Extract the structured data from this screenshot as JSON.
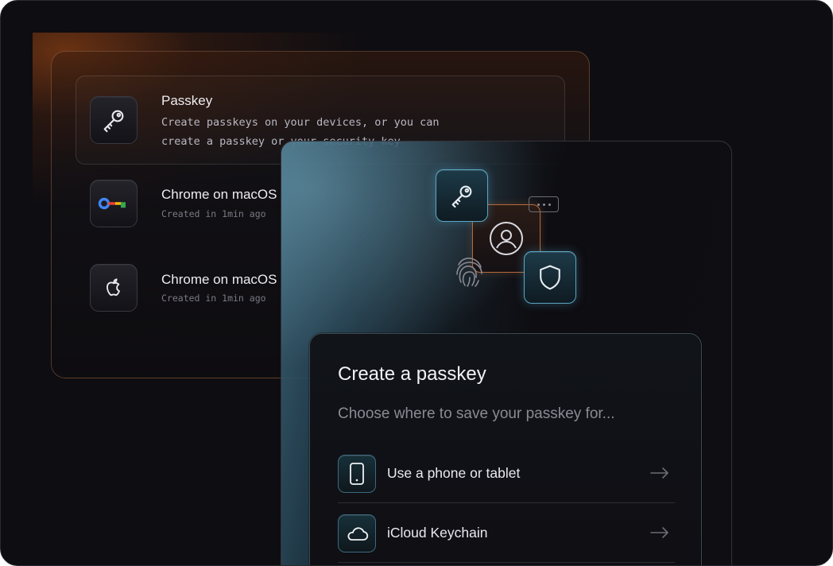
{
  "colors": {
    "background": "#0e0d11",
    "accent_orange": "#b56a3c",
    "accent_blue": "#5aa7c4"
  },
  "back_panel": {
    "items": [
      {
        "icon": "key-icon",
        "title": "Passkey",
        "description": "Create passkeys on your devices, or you can\ncreate a passkey or your security key"
      },
      {
        "icon": "google-password-manager-icon",
        "title": "Chrome on macOS",
        "meta": "Created in 1min ago"
      },
      {
        "icon": "apple-logo-icon",
        "title": "Chrome on macOS",
        "meta": "Created in 1min ago"
      }
    ]
  },
  "illustration": {
    "icons": [
      "key-icon",
      "user-icon",
      "shield-icon",
      "fingerprint-icon",
      "password-dots-icon"
    ]
  },
  "dialog": {
    "title": "Create a passkey",
    "subtitle": "Choose where to save your passkey for...",
    "options": [
      {
        "icon": "phone-icon",
        "label": "Use a phone or tablet"
      },
      {
        "icon": "cloud-icon",
        "label": "iCloud Keychain"
      }
    ]
  }
}
